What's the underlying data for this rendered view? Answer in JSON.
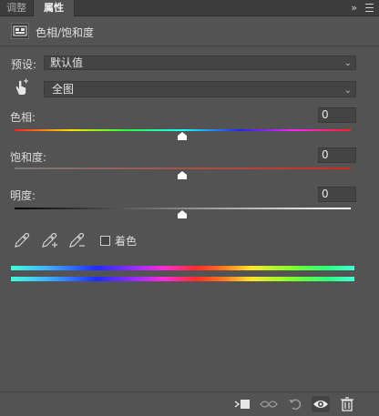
{
  "tabs": [
    {
      "label": "调整",
      "active": false
    },
    {
      "label": "属性",
      "active": true
    }
  ],
  "tabbar_icons": {
    "collapse": "double-chevron-right-icon",
    "menu": "hamburger-menu-icon"
  },
  "panel": {
    "title": "色相/饱和度",
    "icon": "hue-saturation-adjustment-icon"
  },
  "preset": {
    "label": "预设:",
    "value": "默认值"
  },
  "channel": {
    "icon": "targeted-adjustment-hand-icon",
    "value": "全图"
  },
  "sliders": {
    "hue": {
      "label": "色相:",
      "value": "0"
    },
    "saturation": {
      "label": "饱和度:",
      "value": "0"
    },
    "lightness": {
      "label": "明度:",
      "value": "0"
    }
  },
  "tools": {
    "eyedropper": "eyedropper-icon",
    "eyedropper_plus": "eyedropper-add-icon",
    "eyedropper_minus": "eyedropper-subtract-icon",
    "colorize_label": "着色",
    "colorize_checked": false
  },
  "footer_icons": [
    "clip-to-layer-icon",
    "view-previous-state-icon",
    "reset-icon",
    "visibility-eye-icon",
    "trash-icon"
  ]
}
